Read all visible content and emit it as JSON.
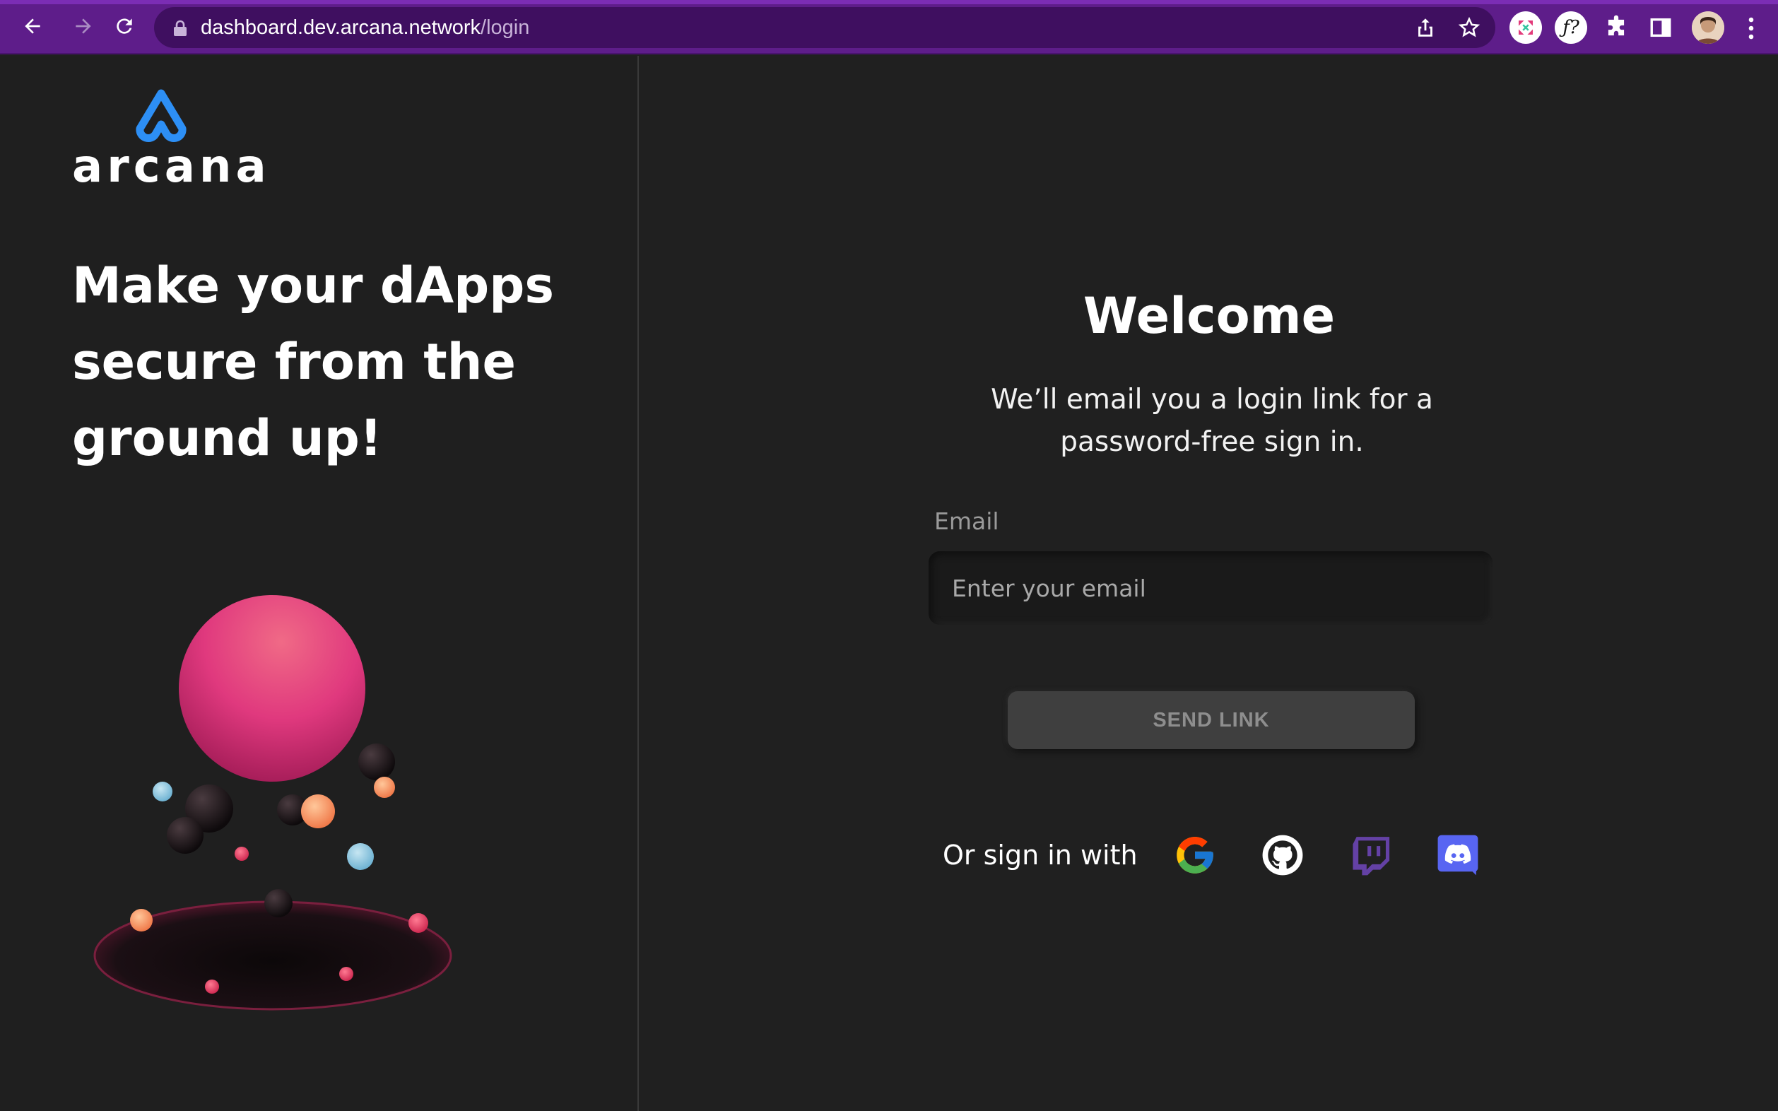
{
  "browser": {
    "url_host": "dashboard.dev.arcana.network",
    "url_path": "/login"
  },
  "brand": {
    "name": "arcana",
    "logo_color": "#2d8ff5"
  },
  "left_panel": {
    "tagline_lines": [
      "Make your dApps",
      "secure from the",
      "ground up!"
    ]
  },
  "login": {
    "title": "Welcome",
    "subtitle_lines": [
      "We’ll email you a login link for a",
      "password-free sign in."
    ],
    "email_label": "Email",
    "email_placeholder": "Enter your email",
    "email_value": "",
    "send_button": "SEND LINK",
    "social_prompt": "Or sign in with",
    "providers": [
      "google",
      "github",
      "twitch",
      "discord"
    ]
  },
  "colors": {
    "chrome": "#5e1d8a",
    "background": "#202020",
    "twitch": "#6441a5",
    "discord": "#5865f2"
  }
}
